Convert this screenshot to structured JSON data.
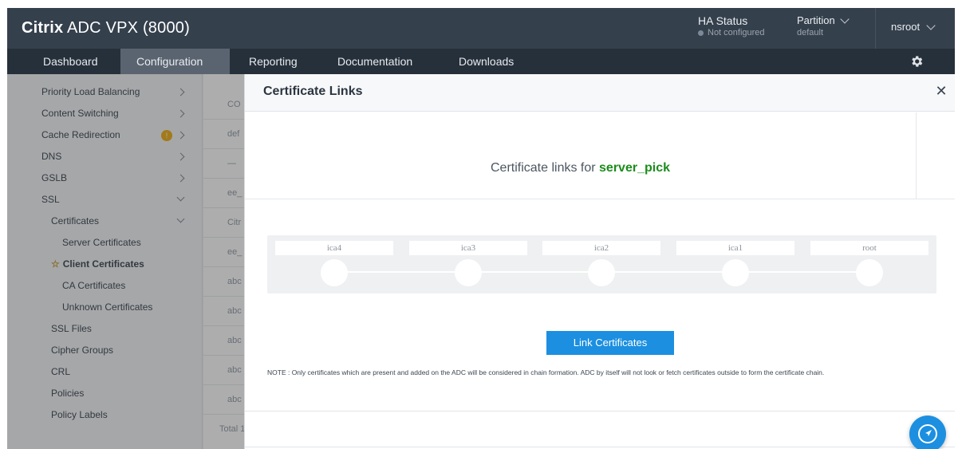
{
  "header": {
    "brand_bold": "Citrix",
    "brand_rest": "ADC VPX (8000)",
    "ha_title": "HA Status",
    "ha_value": "Not configured",
    "partition_title": "Partition",
    "partition_value": "default",
    "user": "nsroot"
  },
  "nav": {
    "tabs": [
      {
        "label": "Dashboard"
      },
      {
        "label": "Configuration"
      },
      {
        "label": "Reporting"
      },
      {
        "label": "Documentation"
      },
      {
        "label": "Downloads"
      }
    ],
    "active_tab": "Configuration"
  },
  "sidebar": {
    "items": [
      {
        "label": "Priority Load Balancing"
      },
      {
        "label": "Content Switching"
      },
      {
        "label": "Cache Redirection",
        "badge": "!"
      },
      {
        "label": "DNS"
      },
      {
        "label": "GSLB"
      },
      {
        "label": "SSL"
      },
      {
        "label": "Certificates"
      },
      {
        "label": "Server Certificates"
      },
      {
        "label": "Client Certificates"
      },
      {
        "label": "CA Certificates"
      },
      {
        "label": "Unknown Certificates"
      },
      {
        "label": "SSL Files"
      },
      {
        "label": "Cipher Groups"
      },
      {
        "label": "CRL"
      },
      {
        "label": "Policies"
      },
      {
        "label": "Policy Labels"
      }
    ]
  },
  "background_content": {
    "rows": [
      "CO",
      "def",
      "—",
      "ee_",
      "Citr",
      "ee_",
      "abc",
      "abc",
      "abc",
      "abc",
      "abc",
      "Total 1"
    ]
  },
  "modal": {
    "title": "Certificate Links",
    "link_prefix": "Certificate links for",
    "cert_name": "server_pick",
    "chain": [
      {
        "label": "ica4"
      },
      {
        "label": "ica3"
      },
      {
        "label": "ica2"
      },
      {
        "label": "ica1"
      },
      {
        "label": "root"
      }
    ],
    "button_label": "Link Certificates",
    "note": "NOTE : Only certificates which are present and added on the ADC will be considered in chain formation. ADC by itself will not look or fetch certificates outside to form the certificate chain."
  },
  "colors": {
    "header_bg": "#35404d",
    "nav_bg": "#26303b",
    "accent": "#1c8fe0",
    "cert_name": "#1b8c1b"
  }
}
